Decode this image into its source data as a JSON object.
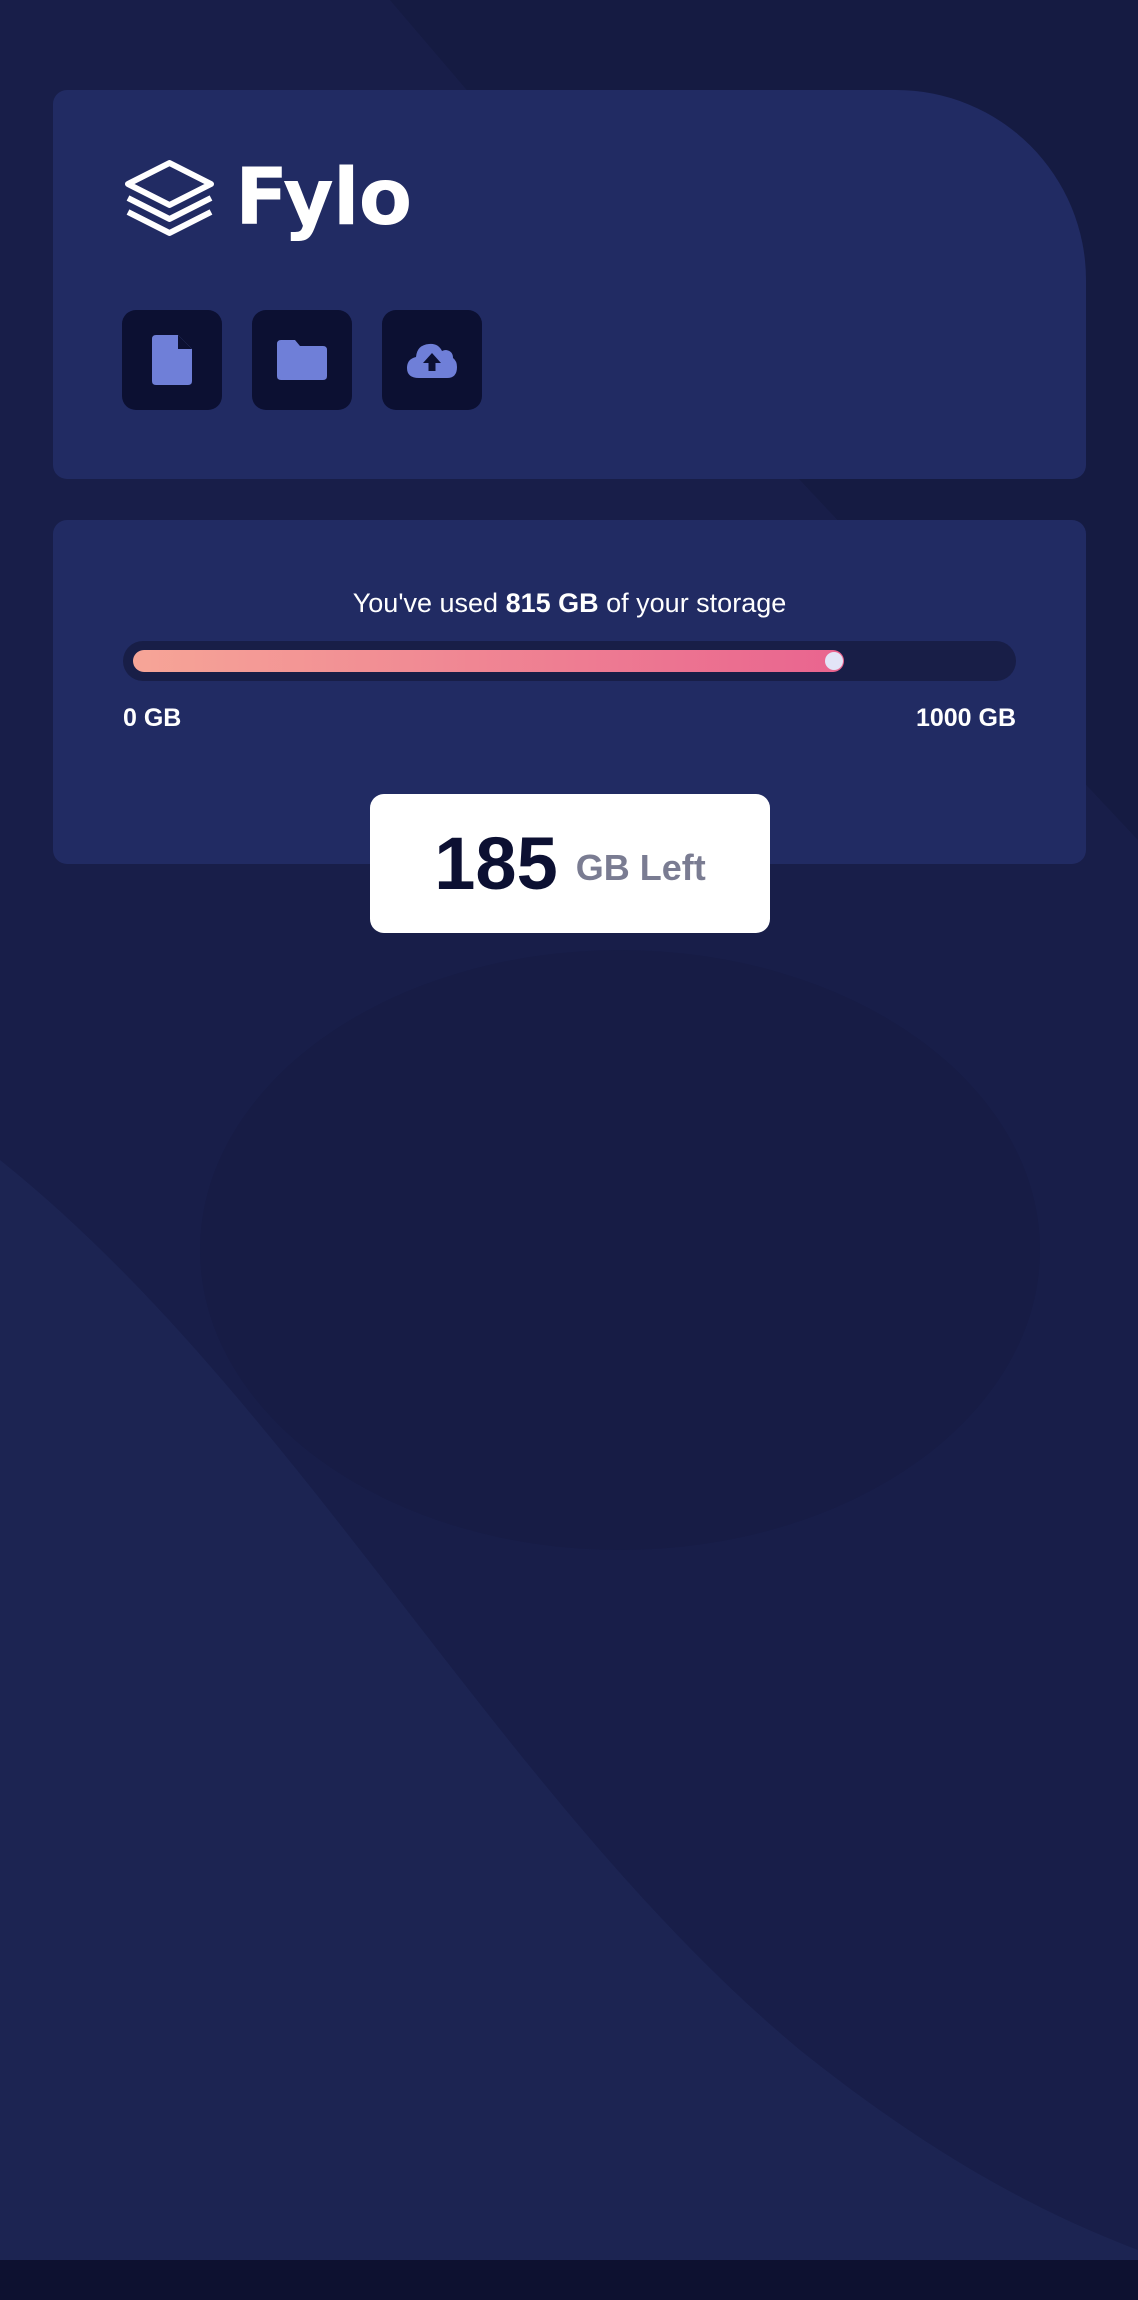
{
  "brand": {
    "name": "Fylo"
  },
  "toolbar": {
    "buttons": [
      {
        "icon": "document-icon"
      },
      {
        "icon": "folder-icon"
      },
      {
        "icon": "upload-icon"
      }
    ]
  },
  "storage": {
    "prefix": "You've used",
    "used": "815 GB",
    "suffix": "of your storage",
    "min_label": "0 GB",
    "max_label": "1000 GB",
    "used_fraction": 0.815,
    "left_number": "185",
    "left_unit": "GB Left"
  },
  "colors": {
    "background": "#181e49",
    "card": "#212b63",
    "icon_tile": "#0c1032",
    "icon": "#6f7fd8",
    "gradient_start": "#f6a597",
    "gradient_end": "#e9648f"
  }
}
